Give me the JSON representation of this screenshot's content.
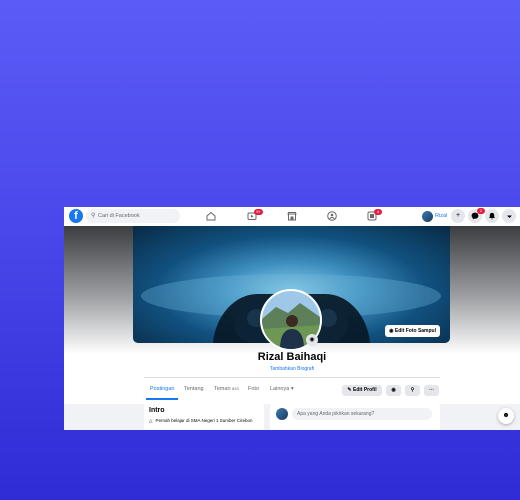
{
  "navbar": {
    "logo": "f",
    "search_placeholder": "Cari di Facebook",
    "video_badge": "9+",
    "groups_badge": "4",
    "messenger_badge": "2",
    "user_name": "Rizal",
    "icons": [
      "home-icon",
      "video-icon",
      "marketplace-icon",
      "groups-icon",
      "gaming-icon",
      "plus-icon",
      "messenger-icon",
      "bell-icon",
      "chevron-down-icon"
    ]
  },
  "cover": {
    "edit_cover_label": "Edit Foto Sampul"
  },
  "profile": {
    "name": "Rizal Baihaqi",
    "bio_link": "Tambahkan Biografi"
  },
  "tabs": {
    "items": [
      {
        "label": "Postingan",
        "active": true
      },
      {
        "label": "Tentang"
      },
      {
        "label": "Teman",
        "count": "833"
      },
      {
        "label": "Foto"
      },
      {
        "label": "Lainnya"
      }
    ],
    "edit_profile_label": "Edit Profil"
  },
  "intro": {
    "title": "Intro",
    "line1": "Pernah belajar di SMA Negeri 1 Sumber Cirebon"
  },
  "composer": {
    "placeholder": "Apa yang Anda pikirkan sekarang?"
  },
  "colors": {
    "brand": "#1877f2",
    "background_gradient": [
      "#5b5cf7",
      "#2f2bd6"
    ]
  }
}
